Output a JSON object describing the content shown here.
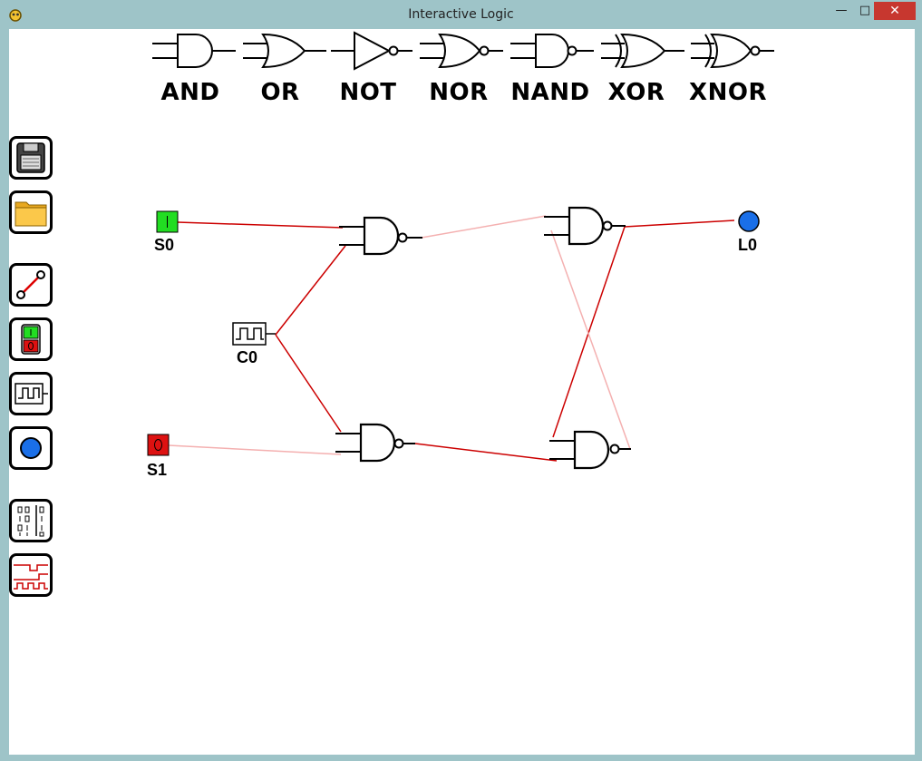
{
  "window": {
    "title": "Interactive Logic",
    "minimize": "—",
    "maximize": "□",
    "close": "✕"
  },
  "palette": {
    "gates": [
      {
        "label": "AND",
        "icon": "and-gate-icon"
      },
      {
        "label": "OR",
        "icon": "or-gate-icon"
      },
      {
        "label": "NOT",
        "icon": "not-gate-icon"
      },
      {
        "label": "NOR",
        "icon": "nor-gate-icon"
      },
      {
        "label": "NAND",
        "icon": "nand-gate-icon"
      },
      {
        "label": "XOR",
        "icon": "xor-gate-icon"
      },
      {
        "label": "XNOR",
        "icon": "xnor-gate-icon"
      }
    ]
  },
  "toolbar": {
    "tools": [
      "save-icon",
      "open-folder-icon",
      "wire-tool-icon",
      "switch-tool-icon",
      "clock-tool-icon",
      "lamp-tool-icon",
      "truth-table-icon",
      "timing-diagram-icon"
    ]
  },
  "circuit": {
    "switches": [
      {
        "name": "S0",
        "state": "1",
        "color": "#22dd22"
      },
      {
        "name": "S1",
        "state": "0",
        "color": "#dd1111"
      }
    ],
    "clock": {
      "name": "C0"
    },
    "lamp": {
      "name": "L0",
      "color": "#1a6fe8"
    },
    "colors": {
      "wire_on": "#cc0000",
      "wire_off": "#f4b0b0"
    }
  }
}
